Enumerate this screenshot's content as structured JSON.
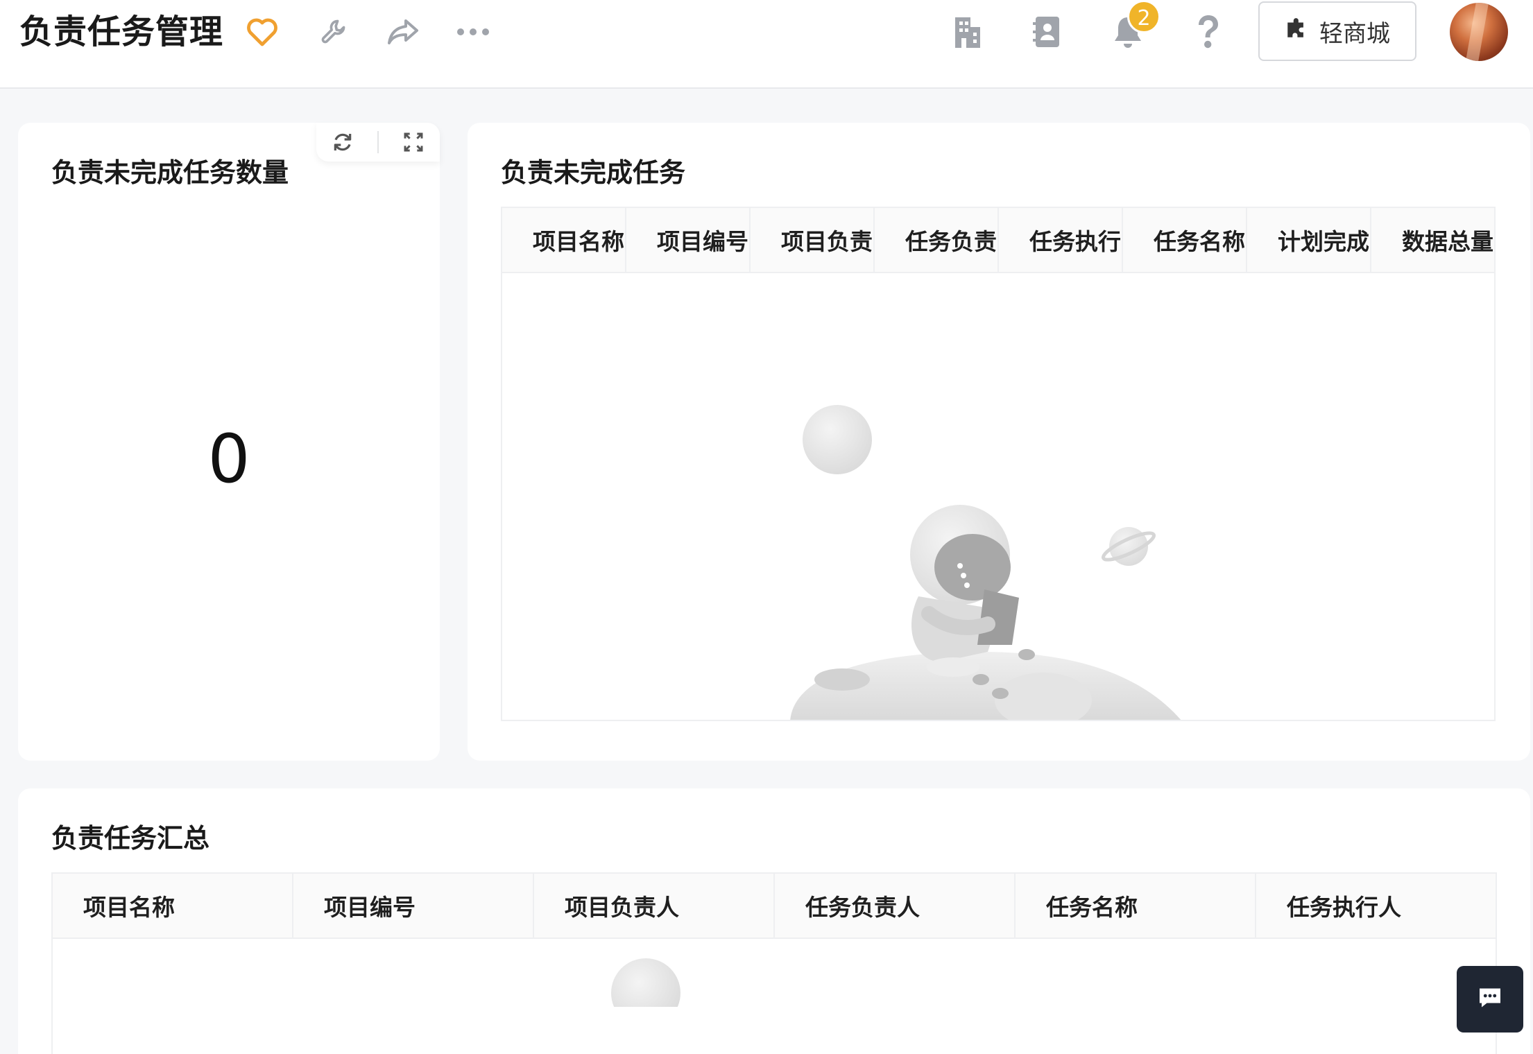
{
  "header": {
    "title": "负责任务管理",
    "favorite_icon": "heart-outline-icon",
    "favorite_color": "#f0a030",
    "tool_icons": [
      "wrench-icon",
      "share-icon",
      "more-horizontal-icon"
    ],
    "right_icons": [
      "building-icon",
      "contacts-icon",
      "bell-icon",
      "help-icon"
    ],
    "notification_count": "2",
    "shop_button": {
      "icon": "puzzle-icon",
      "label": "轻商城"
    },
    "avatar": "user-avatar"
  },
  "cards": {
    "incomplete_count": {
      "title": "负责未完成任务数量",
      "value": "0",
      "toolbar": [
        "refresh-icon",
        "fullscreen-icon"
      ]
    },
    "incomplete_tasks": {
      "title": "负责未完成任务",
      "columns": [
        "项目名称",
        "项目编号",
        "项目负责",
        "任务负责",
        "任务执行",
        "任务名称",
        "计划完成",
        "数据总量"
      ],
      "rows": []
    },
    "task_summary": {
      "title": "负责任务汇总",
      "columns": [
        "项目名称",
        "项目编号",
        "项目负责人",
        "任务负责人",
        "任务名称",
        "任务执行人"
      ],
      "rows": []
    }
  },
  "chat_button": {
    "icon": "chat-bubble-icon"
  },
  "colors": {
    "page_bg": "#f6f7f9",
    "card_bg": "#ffffff",
    "badge": "#f0b429",
    "icon_gray": "#a0a4ab",
    "chat_bg": "#1f2633"
  }
}
